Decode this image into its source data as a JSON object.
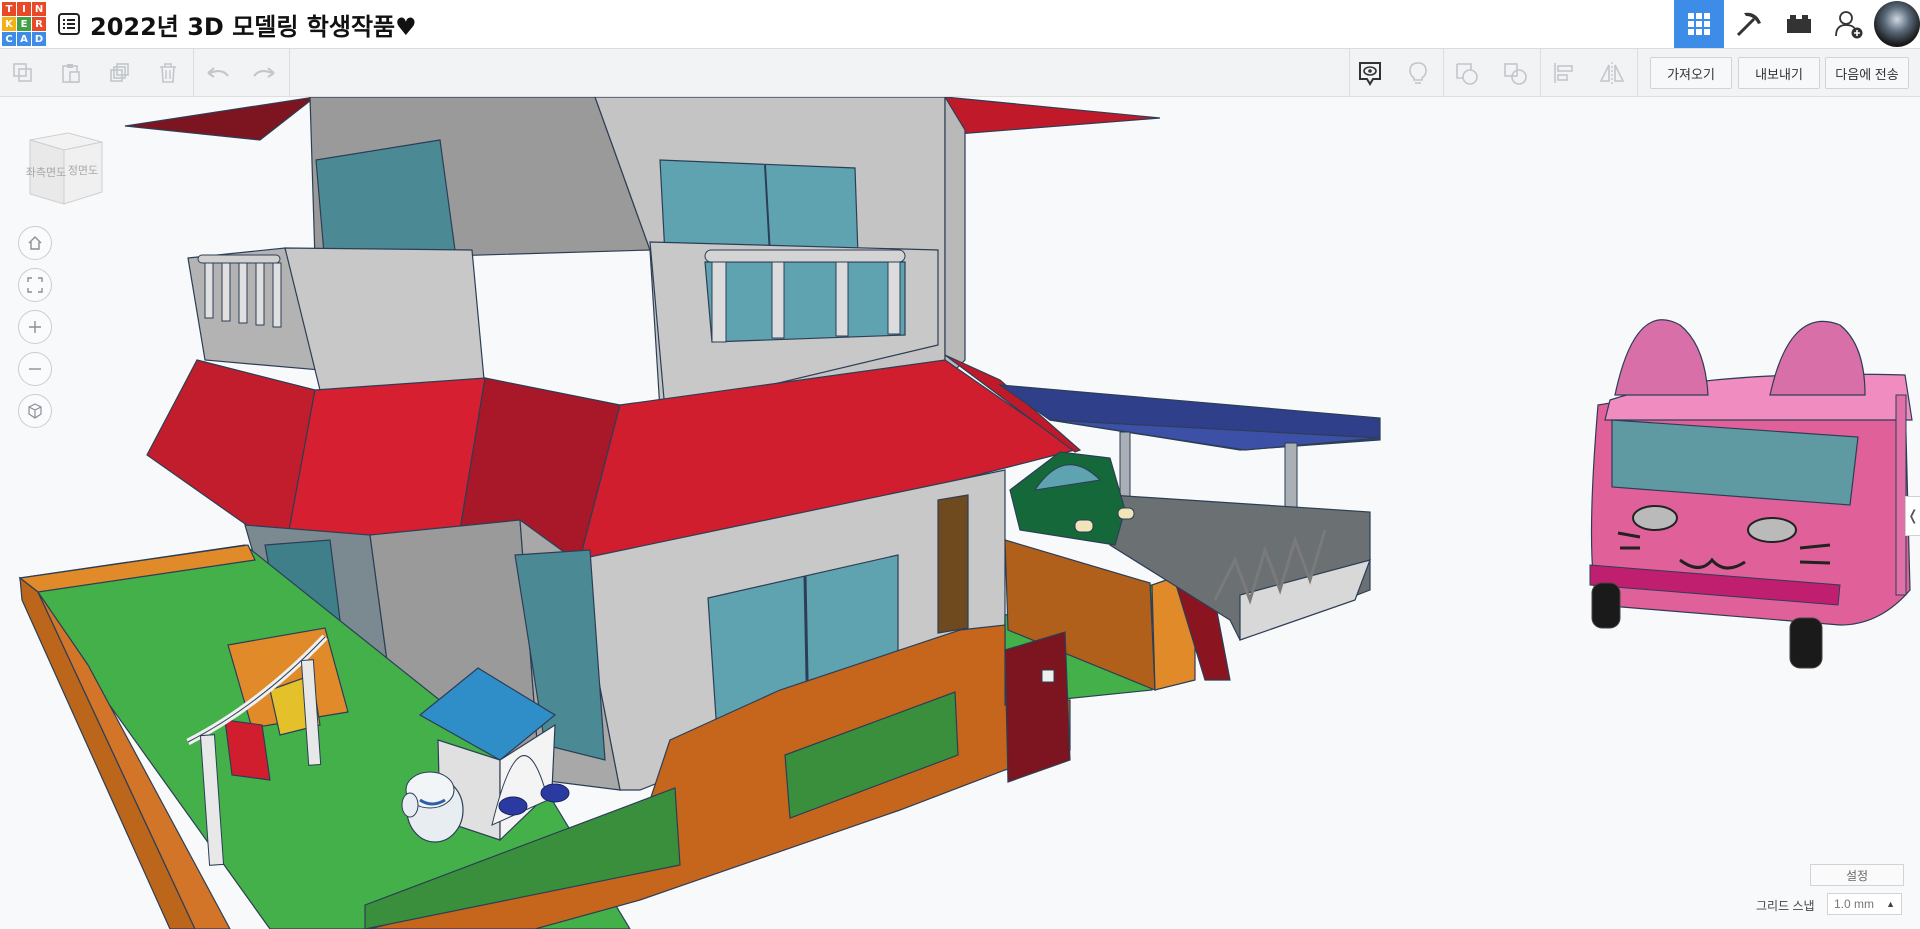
{
  "app": {
    "logo_letters": [
      "T",
      "I",
      "N",
      "K",
      "E",
      "R",
      "C",
      "A",
      "D"
    ],
    "logo_colors": [
      "#e84a27",
      "#e84a27",
      "#e84a27",
      "#f5b016",
      "#43a047",
      "#e84a27",
      "#3d8ce7",
      "#3d8ce7",
      "#3d8ce7"
    ],
    "title": "2022년 3D 모델링 학생작품♥"
  },
  "topbar": {
    "buttons": [
      {
        "name": "3d-design-grid-icon",
        "active": true
      },
      {
        "name": "codeblocks-pickaxe-icon",
        "active": false
      },
      {
        "name": "bricks-icon",
        "active": false
      },
      {
        "name": "add-user-icon",
        "active": false
      }
    ],
    "accent": "#3d8ce7"
  },
  "toolbar": {
    "import_label": "가져오기",
    "export_label": "내보내기",
    "send_to_label": "다음에 전송"
  },
  "viewcube": {
    "left_face": "좌측면도",
    "front_face": "정면도"
  },
  "bottom": {
    "settings_label": "설정",
    "grid_snap_label": "그리드 스냅",
    "grid_snap_value": "1.0 mm"
  }
}
